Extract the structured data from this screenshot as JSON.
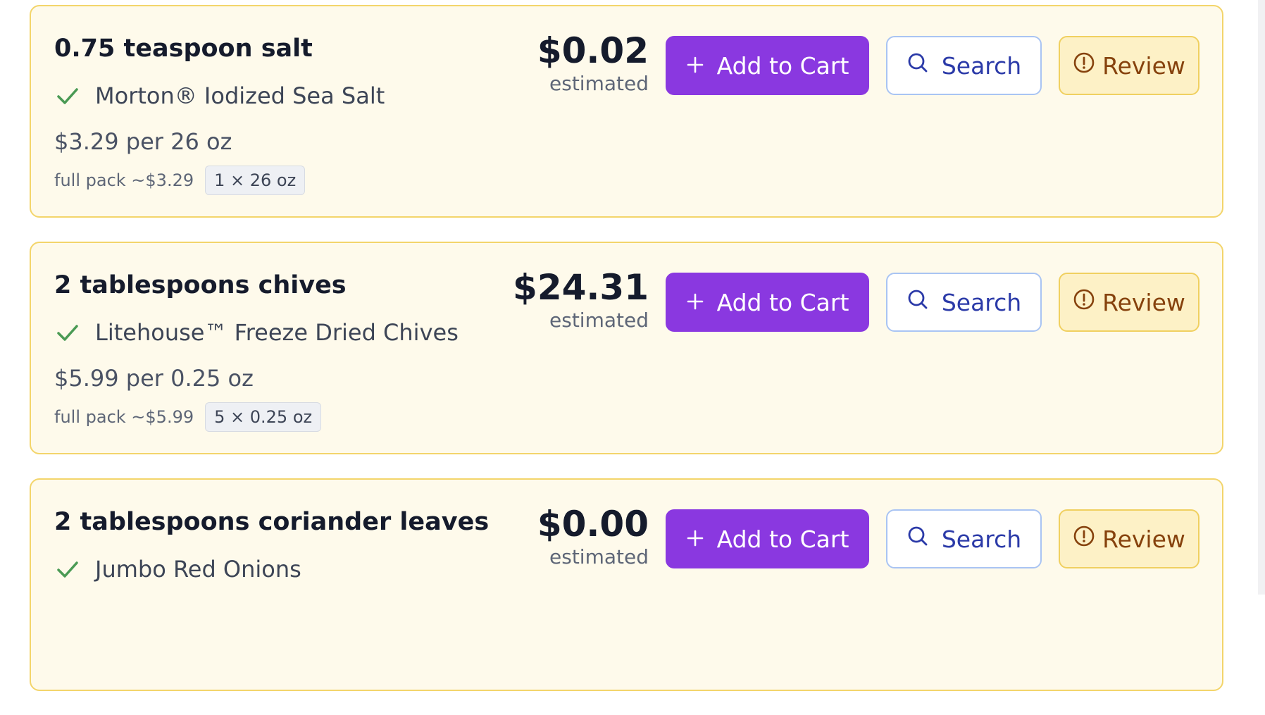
{
  "colors": {
    "card_background": "#fefaeb",
    "card_border": "#f3d56b",
    "add_to_cart": "#8a38e0",
    "search_border": "#a9c4f3",
    "search_text": "#2b3aa8",
    "review_background": "#fdf1c6",
    "review_text": "#86420d",
    "check": "#4a9a54"
  },
  "icons": {
    "match": "check-icon",
    "add_to_cart": "plus-icon",
    "search": "search-icon",
    "review": "alert-circle-icon"
  },
  "items": [
    {
      "ingredient": "0.75 teaspoon salt",
      "match": "Morton® Iodized Sea Salt",
      "unit_price": "$3.29 per 26 oz",
      "full_pack": "full pack ~$3.29",
      "pack_badge": "1 × 26 oz",
      "price": "$0.02",
      "price_note": "estimated",
      "add_label": "Add to Cart",
      "search_label": "Search",
      "review_label": "Review"
    },
    {
      "ingredient": "2 tablespoons chives",
      "match": "Litehouse™ Freeze Dried Chives",
      "unit_price": "$5.99 per 0.25 oz",
      "full_pack": "full pack ~$5.99",
      "pack_badge": "5 × 0.25 oz",
      "price": "$24.31",
      "price_note": "estimated",
      "add_label": "Add to Cart",
      "search_label": "Search",
      "review_label": "Review"
    },
    {
      "ingredient": "2 tablespoons coriander leaves",
      "match": "Jumbo Red Onions",
      "price": "$0.00",
      "price_note": "estimated",
      "add_label": "Add to Cart",
      "search_label": "Search",
      "review_label": "Review"
    }
  ]
}
